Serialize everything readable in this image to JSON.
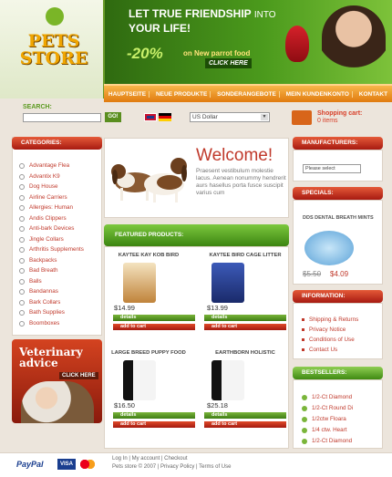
{
  "logo": {
    "text": "PETS\nSTORE",
    "line1": "PETS",
    "line2": "STORE"
  },
  "banner": {
    "headline_1": "LET TRUE FRIENDSHIP",
    "headline_1b": "INTO",
    "headline_2": "YOUR LIFE!",
    "promo": "-20%",
    "promo_sub": "on New parrot food",
    "cta": "CLICK HERE"
  },
  "nav": [
    "HAUPTSEITE",
    "NEUE PRODUKTE",
    "SONDERANGEBOTE",
    "MEIN KUNDENKONTO",
    "KONTAKT"
  ],
  "search": {
    "label": "SEARCH:",
    "button": "GO!"
  },
  "currency": {
    "selected": "US Dollar"
  },
  "cart": {
    "label": "Shopping cart:",
    "count": "0 items"
  },
  "categories": {
    "title": "CATEGORIES:",
    "items": [
      "Advantage Flea",
      "Advantix K9",
      "Dog House",
      "Airline Carriers",
      "Allergies: Human",
      "Andis Clippers",
      "Anti-bark Devices",
      "Jingle Collars",
      "Arthritis Supplements",
      "Backpacks",
      "Bad Breath",
      "Balls",
      "Bandannas",
      "Bark Collars",
      "Bath Supplies",
      "Boomboxes"
    ]
  },
  "vet": {
    "title_1": "Veterinary",
    "title_2": "advice",
    "cta": "CLICK HERE"
  },
  "welcome": {
    "title": "Welcome!",
    "text": "Praesent vestibulum molestie lacus. Aenean nonummy hendrerit aurs hasellus porta fusce suscipit varius cum"
  },
  "featured": {
    "title": "FEATURED PRODUCTS:",
    "details_label": "details",
    "cart_label": "add to cart",
    "products": [
      {
        "name": "KAYTEE KAY KOB BIRD",
        "price": "$14.99",
        "color": "#c0833a"
      },
      {
        "name": "KAYTEE BIRD CAGE LITTER",
        "price": "$13.99",
        "color": "#2a3c8a"
      },
      {
        "name": "LARGE BREED PUPPY FOOD",
        "price": "$16.50",
        "color": "#e0e0e0"
      },
      {
        "name": "EARTHBORN HOLISTIC",
        "price": "$25.18",
        "color": "#e0e0e0"
      }
    ]
  },
  "manufacturers": {
    "title": "MANUFACTURERS:",
    "select": "Please select"
  },
  "specials": {
    "title": "SPECIALS:",
    "name": "DDS DENTAL BREATH MINTS",
    "old_price": "$5.50",
    "new_price": "$4.09"
  },
  "information": {
    "title": "INFORMATION:",
    "items": [
      "Shipping & Returns",
      "Privacy Notice",
      "Conditions of Use",
      "Contact Us"
    ]
  },
  "bestsellers": {
    "title": "BESTSELLERS:",
    "items": [
      "1/2-Ct Diamond",
      "1/2-Ct Round Di",
      "1/2ctw Floara",
      "1/4 ctw. Heart",
      "1/2-Ct Diamond"
    ]
  },
  "footer": {
    "links": "Log In  |  My account  |  Checkout",
    "copyright": "Pets store © 2007  |  Privacy Policy  |  Terms of Use",
    "paypal": "PayPal",
    "visa": "VISA"
  },
  "colors": {
    "green": "#3e7d18",
    "orange": "#e07a0e",
    "red": "#c0392b"
  }
}
